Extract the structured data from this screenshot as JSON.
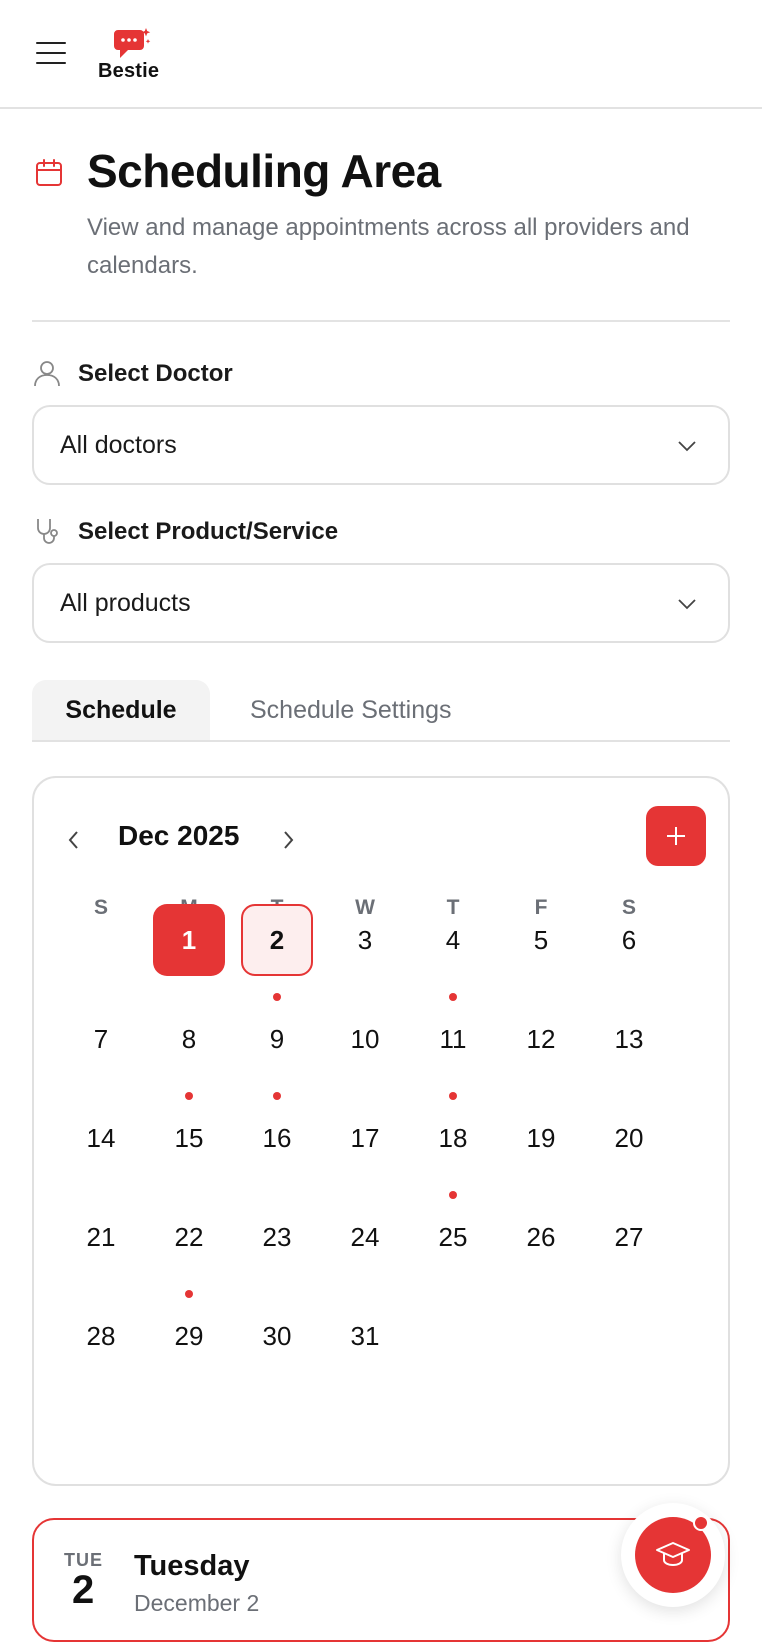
{
  "header": {
    "logo_text": "Bestie"
  },
  "page": {
    "title": "Scheduling Area",
    "subtitle": "View and manage appointments across all providers and calendars."
  },
  "filters": {
    "doctor_label": "Select Doctor",
    "doctor_value": "All doctors",
    "product_label": "Select Product/Service",
    "product_value": "All products"
  },
  "tabs": [
    {
      "label": "Schedule",
      "active": true
    },
    {
      "label": "Schedule Settings",
      "active": false
    }
  ],
  "calendar": {
    "month_label": "Dec 2025",
    "weekdays": [
      "S",
      "M",
      "T",
      "W",
      "T",
      "F",
      "S"
    ],
    "first_weekday_index": 1,
    "days_in_month": 31,
    "today": 1,
    "selected": 2,
    "days_with_events": [
      2,
      4,
      8,
      9,
      11,
      18,
      22
    ]
  },
  "selected_day": {
    "abbr": "TUE",
    "number": "2",
    "name": "Tuesday",
    "date": "December 2"
  },
  "colors": {
    "accent": "#e53535",
    "muted_text": "#6b6f76",
    "border": "#e0e0e0"
  },
  "icons": {
    "menu": "menu-icon",
    "title": "calendar-icon",
    "doctor": "user-icon",
    "product": "stethoscope-icon",
    "fab": "graduation-cap-icon"
  }
}
